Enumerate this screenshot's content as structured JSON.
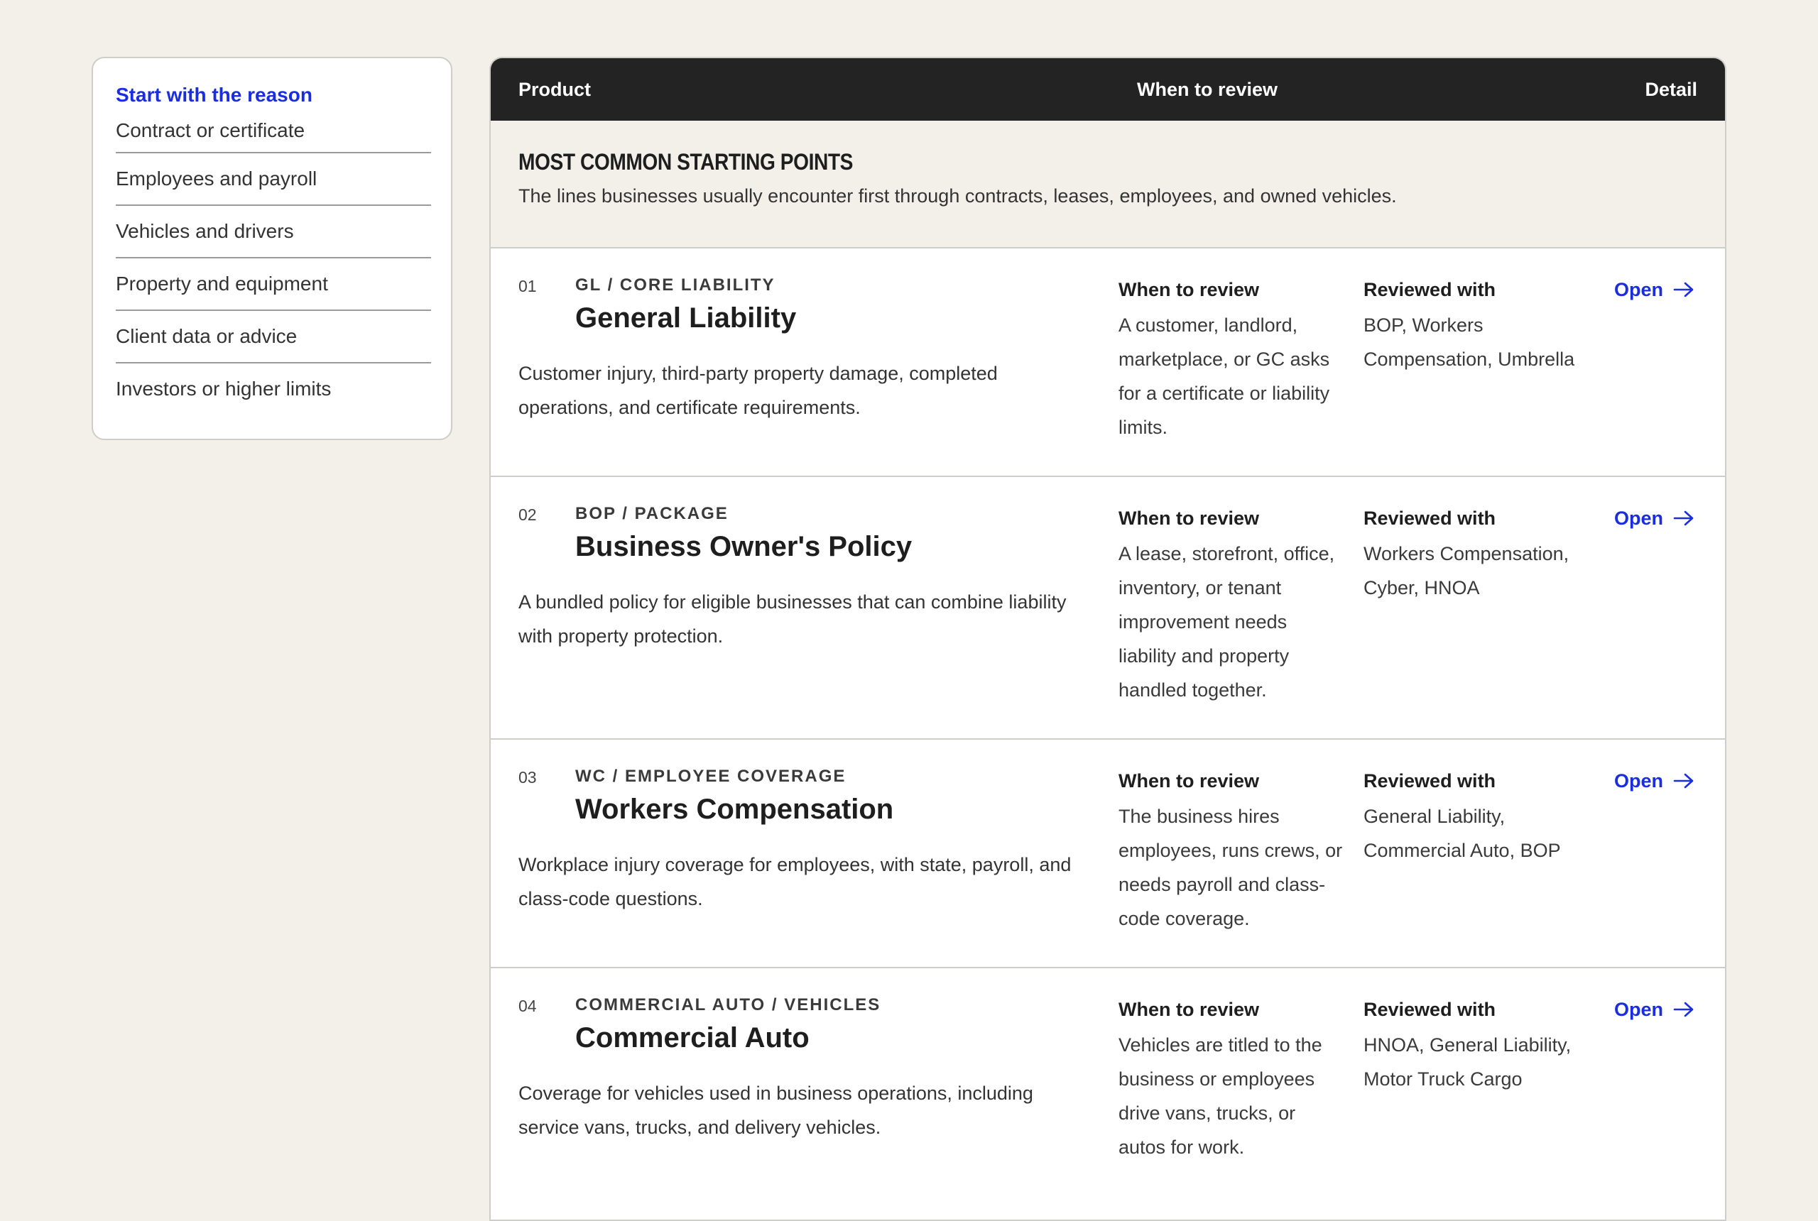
{
  "sidebar": {
    "heading": "Start with the reason",
    "items": [
      {
        "label": "Contract or certificate"
      },
      {
        "label": "Employees and payroll"
      },
      {
        "label": "Vehicles and drivers"
      },
      {
        "label": "Property and equipment"
      },
      {
        "label": "Client data or advice"
      },
      {
        "label": "Investors or higher limits"
      }
    ]
  },
  "table": {
    "headers": {
      "product": "Product",
      "when": "When to review",
      "detail": "Detail"
    },
    "section": {
      "title": "MOST COMMON STARTING POINTS",
      "description": "The lines businesses usually encounter first through contracts, leases, employees, and owned vehicles."
    },
    "rows": [
      {
        "number": "01",
        "eyebrow": "GL / CORE LIABILITY",
        "title": "General Liability",
        "description": "Customer injury, third-party property damage, completed operations, and certificate requirements.",
        "when_label": "When to review",
        "when_text": "A customer, landlord, marketplace, or GC asks for a certificate or liability limits.",
        "with_label": "Reviewed with",
        "with_text": "BOP, Workers Compensation, Umbrella",
        "link": "Open"
      },
      {
        "number": "02",
        "eyebrow": "BOP / PACKAGE",
        "title": "Business Owner's Policy",
        "description": "A bundled policy for eligible businesses that can combine liability with property protection.",
        "when_label": "When to review",
        "when_text": "A lease, storefront, office, inventory, or tenant improvement needs liability and property handled together.",
        "with_label": "Reviewed with",
        "with_text": "Workers Compensation, Cyber, HNOA",
        "link": "Open"
      },
      {
        "number": "03",
        "eyebrow": "WC / EMPLOYEE COVERAGE",
        "title": "Workers Compensation",
        "description": "Workplace injury coverage for employees, with state, payroll, and class-code questions.",
        "when_label": "When to review",
        "when_text": "The business hires employees, runs crews, or needs payroll and class-code coverage.",
        "with_label": "Reviewed with",
        "with_text": "General Liability, Commercial Auto, BOP",
        "link": "Open"
      },
      {
        "number": "04",
        "eyebrow": "COMMERCIAL AUTO / VEHICLES",
        "title": "Commercial Auto",
        "description": "Coverage for vehicles used in business operations, including service vans, trucks, and delivery vehicles.",
        "when_label": "When to review",
        "when_text": "Vehicles are titled to the business or employees drive vans, trucks, or autos for work.",
        "with_label": "Reviewed with",
        "with_text": "HNOA, General Liability, Motor Truck Cargo",
        "link": "Open"
      }
    ]
  },
  "colors": {
    "accent": "#1a2ee0",
    "header_bg": "#232323",
    "page_bg": "#f3f0ea"
  }
}
